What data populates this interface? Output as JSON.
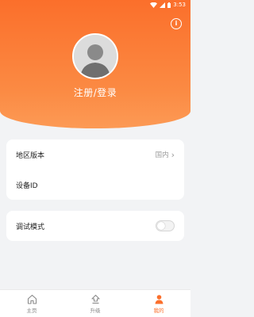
{
  "status_bar": {
    "time": "3:53"
  },
  "header": {
    "login_label": "注册/登录"
  },
  "settings": {
    "region": {
      "label": "地区版本",
      "value": "国内"
    },
    "device_id": {
      "label": "设备ID"
    },
    "debug_mode": {
      "label": "调试模式",
      "enabled": false
    }
  },
  "nav": [
    {
      "label": "主页",
      "icon": "home-icon"
    },
    {
      "label": "升级",
      "icon": "upgrade-icon"
    },
    {
      "label": "我的",
      "icon": "person-icon",
      "active": true
    }
  ],
  "colors": {
    "accent": "#fb6f2b",
    "background": "#f2f3f5"
  }
}
